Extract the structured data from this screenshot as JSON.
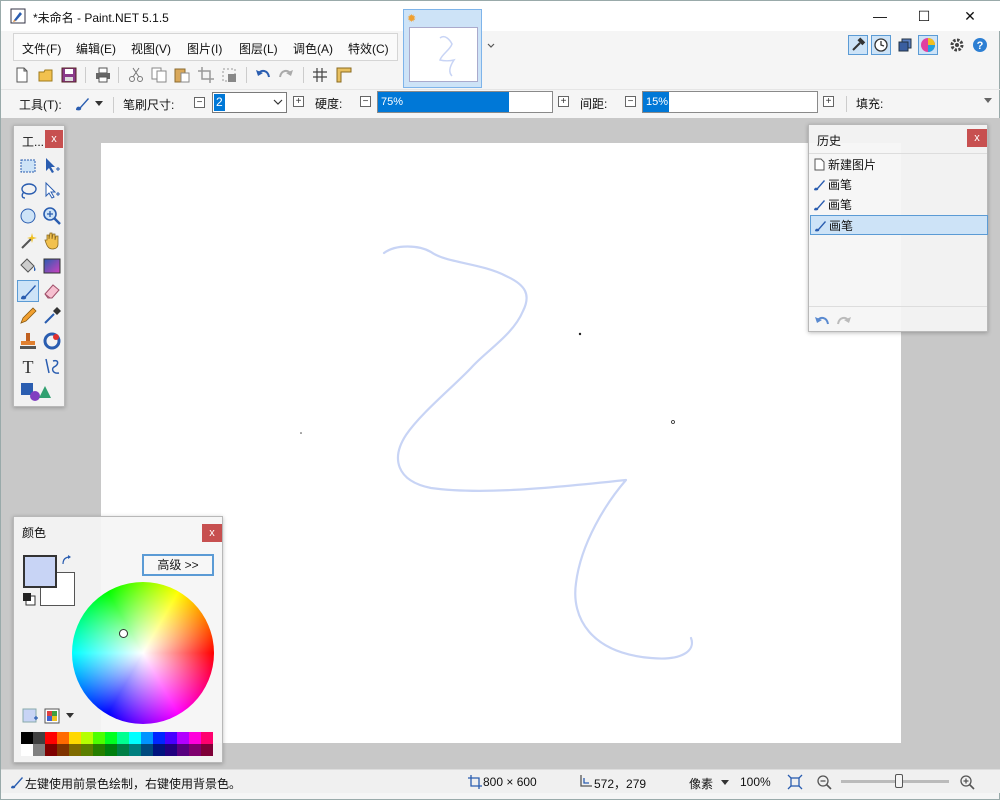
{
  "window": {
    "title": "*未命名 - Paint.NET 5.1.5",
    "controls": {
      "minimize": "—",
      "maximize": "☐",
      "close": "✕"
    }
  },
  "menu": {
    "items": [
      "文件(F)",
      "编辑(E)",
      "视图(V)",
      "图片(I)",
      "图层(L)",
      "调色(A)",
      "特效(C)"
    ],
    "overflow_icon": "chevron-down-icon"
  },
  "top_right_icons": [
    "hammer-icon",
    "history-icon",
    "layers-icon",
    "colors-icon",
    "gear-icon",
    "help-icon"
  ],
  "toolbar": {
    "icons": [
      "new-file-icon",
      "open-folder-icon",
      "save-icon",
      "print-icon",
      "cut-icon",
      "copy-icon",
      "paste-icon",
      "crop-icon",
      "deselect-icon",
      "undo-icon",
      "redo-icon",
      "grid-icon",
      "ruler-icon"
    ]
  },
  "tool_options": {
    "tool_label": "工具(T):",
    "brush_size_label": "笔刷尺寸:",
    "brush_size_value": "2",
    "hardness_label": "硬度:",
    "hardness_value": "75%",
    "hardness_fraction": 0.75,
    "spacing_label": "间距:",
    "spacing_value": "15%",
    "spacing_fraction": 0.15,
    "fill_label": "填充:",
    "minus": "⊟",
    "plus": "⊞"
  },
  "tools_panel": {
    "title": "工...",
    "close": "x",
    "tools": [
      "rectangle-select-icon",
      "move-selection-icon",
      "lasso-select-icon",
      "move-selected-icon",
      "ellipse-select-icon",
      "zoom-icon",
      "magic-wand-icon",
      "pan-icon",
      "paint-bucket-icon",
      "gradient-icon",
      "paintbrush-icon",
      "eraser-icon",
      "pencil-icon",
      "color-picker-icon",
      "clone-stamp-icon",
      "recolor-icon",
      "text-icon",
      "line-curve-icon",
      "shapes-icon"
    ],
    "active_tool": "paintbrush-icon"
  },
  "history_panel": {
    "title": "历史",
    "close": "x",
    "items": [
      {
        "label": "新建图片",
        "icon": "new-image-icon",
        "active": false
      },
      {
        "label": "画笔",
        "icon": "paintbrush-icon",
        "active": false
      },
      {
        "label": "画笔",
        "icon": "paintbrush-icon",
        "active": false
      },
      {
        "label": "画笔",
        "icon": "paintbrush-icon",
        "active": true
      }
    ]
  },
  "colors_panel": {
    "title": "颜色",
    "close": "x",
    "advanced_button": "高级 >>",
    "primary_color": "#c8d4f5",
    "secondary_color": "#ffffff",
    "palette": [
      "#000000",
      "#404040",
      "#ff0000",
      "#ff6a00",
      "#ffd800",
      "#b6ff00",
      "#4cff00",
      "#00ff21",
      "#00ff90",
      "#00ffff",
      "#0094ff",
      "#0026ff",
      "#4800ff",
      "#b200ff",
      "#ff00dc",
      "#ff006e",
      "#ffffff",
      "#808080",
      "#7f0000",
      "#7f3300",
      "#7f6a00",
      "#5b7f00",
      "#267f00",
      "#007f0e",
      "#007f46",
      "#007f7f",
      "#004a7f",
      "#00137f",
      "#21007f",
      "#57007f",
      "#7f006e",
      "#7f0037"
    ]
  },
  "statusbar": {
    "hint": "左键使用前景色绘制，右键使用背景色。",
    "image_size": "800 × 600",
    "cursor_position": "572，279",
    "units": "像素",
    "zoom": "100%",
    "zoom_fraction": 0.5
  },
  "colors": {
    "accent": "#0078d7",
    "stroke": "#c8d4f5",
    "close_red": "#c75050",
    "selection_bg": "#cde3f7"
  }
}
